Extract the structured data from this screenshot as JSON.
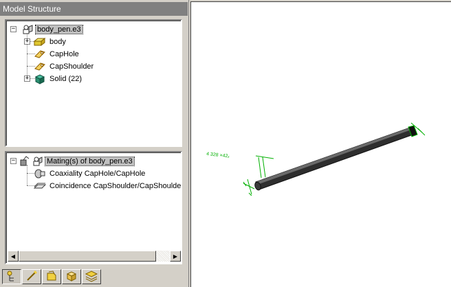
{
  "panel": {
    "title": "Model Structure"
  },
  "structure_tree": {
    "root": {
      "label": "body_pen.e3",
      "icon": "assembly-icon"
    },
    "children": [
      {
        "label": "body",
        "icon": "part-icon",
        "expandable": true
      },
      {
        "label": "CapHole",
        "icon": "mating-feature-icon",
        "expandable": false
      },
      {
        "label": "CapShoulder",
        "icon": "mating-feature-icon",
        "expandable": false
      },
      {
        "label": "Solid (22)",
        "icon": "solid-icon",
        "expandable": true
      }
    ]
  },
  "mating_tree": {
    "root": {
      "label": "Mating(s) of body_pen.e3",
      "icon": "matings-icon"
    },
    "children": [
      {
        "label": "Coaxiality CapHole/CapHole",
        "icon": "coaxiality-icon"
      },
      {
        "label": "Coincidence CapShoulder/CapShoulder",
        "icon": "coincidence-icon"
      }
    ]
  },
  "tabs": [
    {
      "name": "structure-tab",
      "icon": "tree-icon",
      "active": true
    },
    {
      "name": "mating-tab",
      "icon": "wand-icon",
      "active": false
    },
    {
      "name": "features-tab",
      "icon": "features-icon",
      "active": false
    },
    {
      "name": "solid-tab",
      "icon": "cube-icon",
      "active": false
    },
    {
      "name": "layers-tab",
      "icon": "layers-icon",
      "active": false
    }
  ],
  "viewport": {
    "dimension_labels": {
      "length": "4 328 ×42ₓ"
    },
    "colors": {
      "model": "#3a3a3a",
      "dimensions": "#00b000"
    }
  }
}
